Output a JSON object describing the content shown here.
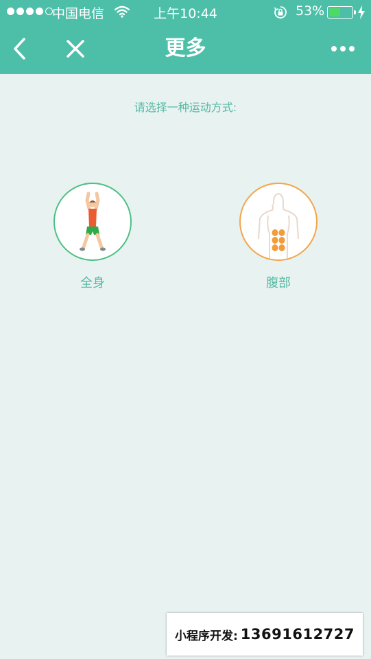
{
  "status_bar": {
    "carrier": "中国电信",
    "time": "上午10:44",
    "battery_percent": "53%",
    "battery_level": 0.53,
    "battery_color": "#4cd964",
    "signal_bars_filled": 4,
    "signal_bars_total": 5,
    "icons": [
      "wifi-icon",
      "rotation-lock-icon",
      "battery-icon",
      "charging-icon"
    ]
  },
  "nav": {
    "title": "更多",
    "back_icon": "chevron-left-icon",
    "close_icon": "close-icon",
    "more_icon": "more-dots-icon"
  },
  "content": {
    "prompt": "请选择一种运动方式:",
    "options": [
      {
        "label": "全身",
        "icon": "full-body-exercise-icon",
        "accent": "#4dbf85"
      },
      {
        "label": "腹部",
        "icon": "abs-muscle-icon",
        "accent": "#f3a54b"
      }
    ]
  },
  "watermark": {
    "label": "小程序开发:",
    "phone": "13691612727"
  },
  "colors": {
    "header": "#4dbfa9",
    "background": "#e8f2f0",
    "text_accent": "#55b9a5"
  }
}
